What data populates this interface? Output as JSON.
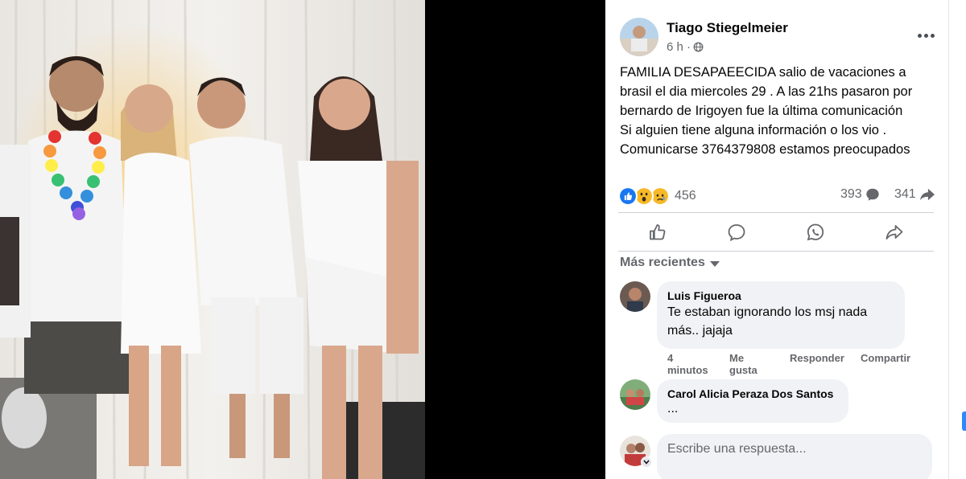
{
  "post": {
    "author": "Tiago Stiegelmeier",
    "time": "6 h ·",
    "lines": [
      "FAMILIA DESAPAEECIDA salio de vacaciones a",
      "brasil el dia miercoles 29 . A las 21hs pasaron por",
      "bernardo de Irigoyen fue la última comunicación",
      "Si alguien tiene alguna información o los vio .",
      "Comunicarse 3764379808 estamos preocupados"
    ],
    "reactions_count": "456",
    "reaction_icons": [
      "like-icon",
      "wow-icon",
      "sad-icon"
    ],
    "comments_count": "393",
    "shares_count": "341"
  },
  "actions": [
    "like-action",
    "comment-action",
    "whatsapp-action",
    "share-action"
  ],
  "sort_label": "Más recientes",
  "comments": [
    {
      "author": "Luis Figueroa",
      "lines": [
        "Te estaban ignorando los msj nada",
        "más.. jajaja"
      ],
      "time": [
        "4",
        "minutos"
      ],
      "like": [
        "Me",
        "gusta"
      ],
      "reply": "Responder",
      "share": "Compartir"
    },
    {
      "author": "Carol Alicia Peraza Dos Santos",
      "lines": [
        "..."
      ]
    }
  ],
  "reply_placeholder": "Escribe una respuesta...",
  "colors": {
    "accent": "#1877f2",
    "bubble": "#f0f2f5",
    "secondary_text": "#65676b"
  }
}
